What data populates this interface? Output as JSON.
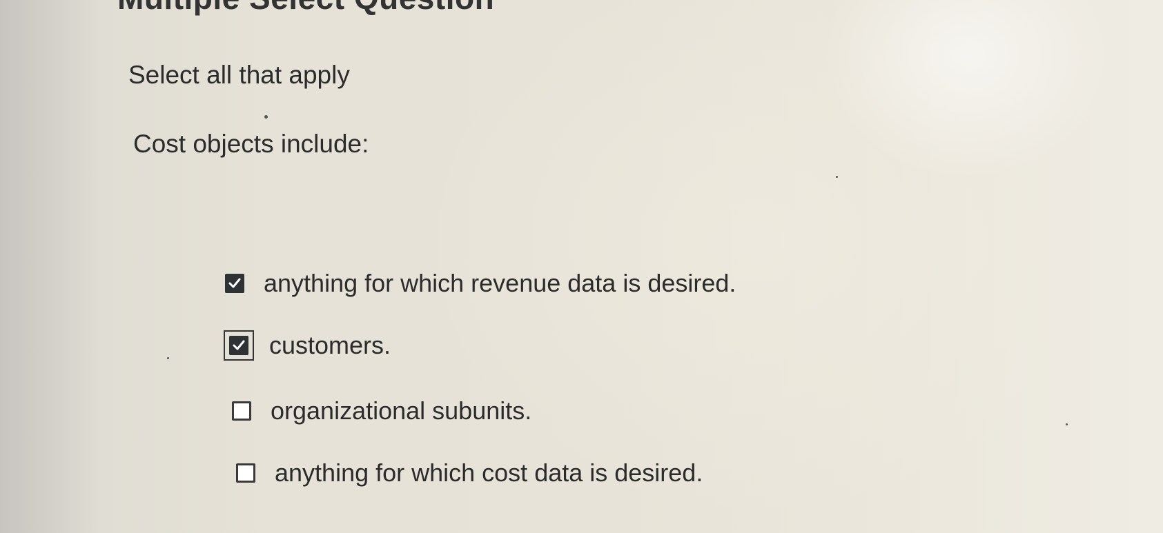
{
  "question": {
    "title": "Multiple Select Question",
    "instruction": "Select all that apply",
    "prompt": "Cost objects include:",
    "options": [
      {
        "label": "anything for which revenue data is desired.",
        "checked": true,
        "focused": false
      },
      {
        "label": "customers.",
        "checked": true,
        "focused": true
      },
      {
        "label": "organizational subunits.",
        "checked": false,
        "focused": false
      },
      {
        "label": "anything for which cost data is desired.",
        "checked": false,
        "focused": false
      }
    ]
  },
  "icons": {
    "checked": "checkmark-icon"
  },
  "colors": {
    "checkbox_checked_fill": "#2e3235",
    "checkmark": "#ffffff",
    "text": "#2b2b2b"
  }
}
